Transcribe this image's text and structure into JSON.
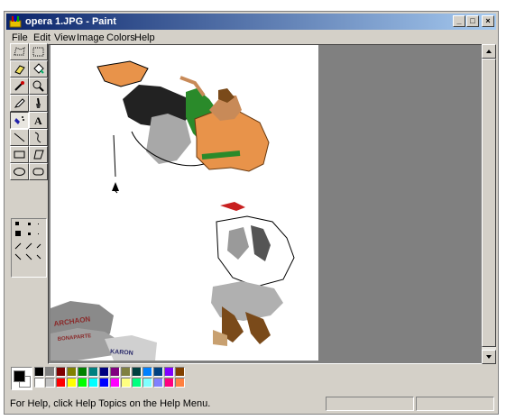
{
  "window": {
    "title": "opera 1.JPG - Paint",
    "controls": {
      "minimize": "_",
      "maximize": "□",
      "close": "×"
    }
  },
  "menu": [
    "File",
    "Edit",
    "View",
    "Image",
    "Colors",
    "Help"
  ],
  "tools": [
    "free-form-select-icon",
    "select-icon",
    "eraser-icon",
    "fill-icon",
    "pick-color-icon",
    "magnifier-icon",
    "pencil-icon",
    "brush-icon",
    "airbrush-icon",
    "text-icon",
    "line-icon",
    "curve-icon",
    "rectangle-icon",
    "polygon-icon",
    "ellipse-icon",
    "rounded-rectangle-icon"
  ],
  "active_tool": "airbrush-icon",
  "palette": {
    "primary": "#000000",
    "secondary": "#ffffff",
    "top_row": [
      "#000000",
      "#808080",
      "#800000",
      "#808000",
      "#008000",
      "#008080",
      "#000080",
      "#800080",
      "#808040",
      "#004040",
      "#0080ff",
      "#004080",
      "#8000ff",
      "#804000"
    ],
    "bottom_row": [
      "#ffffff",
      "#c0c0c0",
      "#ff0000",
      "#ffff00",
      "#00ff00",
      "#00ffff",
      "#0000ff",
      "#ff00ff",
      "#ffff80",
      "#00ff80",
      "#80ffff",
      "#8080ff",
      "#ff0080",
      "#ff8040"
    ]
  },
  "canvas": {
    "text_labels": [
      "ARCHAON",
      "BONAPARTE",
      "KARON"
    ]
  },
  "status": {
    "help_text": "For Help, click Help Topics on the Help Menu."
  }
}
